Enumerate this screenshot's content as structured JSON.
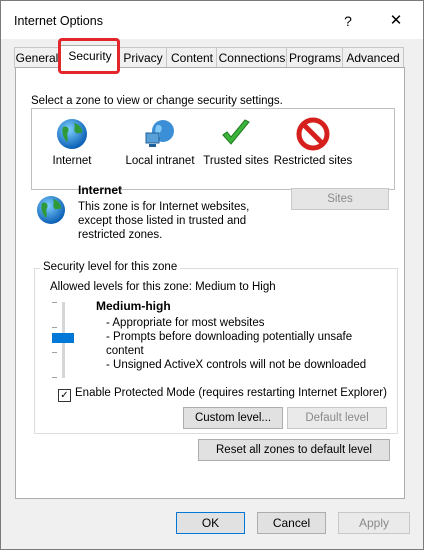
{
  "window": {
    "title": "Internet Options",
    "help_label": "?",
    "close_label": "✕"
  },
  "tabs": [
    {
      "label": "General"
    },
    {
      "label": "Security"
    },
    {
      "label": "Privacy"
    },
    {
      "label": "Content"
    },
    {
      "label": "Connections"
    },
    {
      "label": "Programs"
    },
    {
      "label": "Advanced"
    }
  ],
  "security": {
    "prompt": "Select a zone to view or change security settings.",
    "zones": [
      {
        "label": "Internet",
        "icon": "globe-icon"
      },
      {
        "label": "Local intranet",
        "icon": "network-globe-icon"
      },
      {
        "label": "Trusted sites",
        "icon": "checkmark-icon"
      },
      {
        "label": "Restricted sites",
        "icon": "no-entry-icon"
      }
    ],
    "selected_zone": {
      "title": "Internet",
      "description": "This zone is for Internet websites, except those listed in trusted and restricted zones.",
      "sites_label": "Sites"
    },
    "level_group": {
      "legend": "Security level for this zone",
      "allowed": "Allowed levels for this zone: Medium to High",
      "level_name": "Medium-high",
      "level_lines": [
        "- Appropriate for most websites",
        "- Prompts before downloading potentially unsafe content",
        "- Unsigned ActiveX controls will not be downloaded"
      ],
      "protected_mode_label": "Enable Protected Mode (requires restarting Internet Explorer)",
      "protected_mode_checked": true,
      "custom_level_label": "Custom level...",
      "default_level_label": "Default level"
    },
    "reset_all_label": "Reset all zones to default level"
  },
  "footer": {
    "ok_label": "OK",
    "cancel_label": "Cancel",
    "apply_label": "Apply"
  },
  "colors": {
    "highlight": "#e2262b",
    "slider": "#0078d7"
  }
}
